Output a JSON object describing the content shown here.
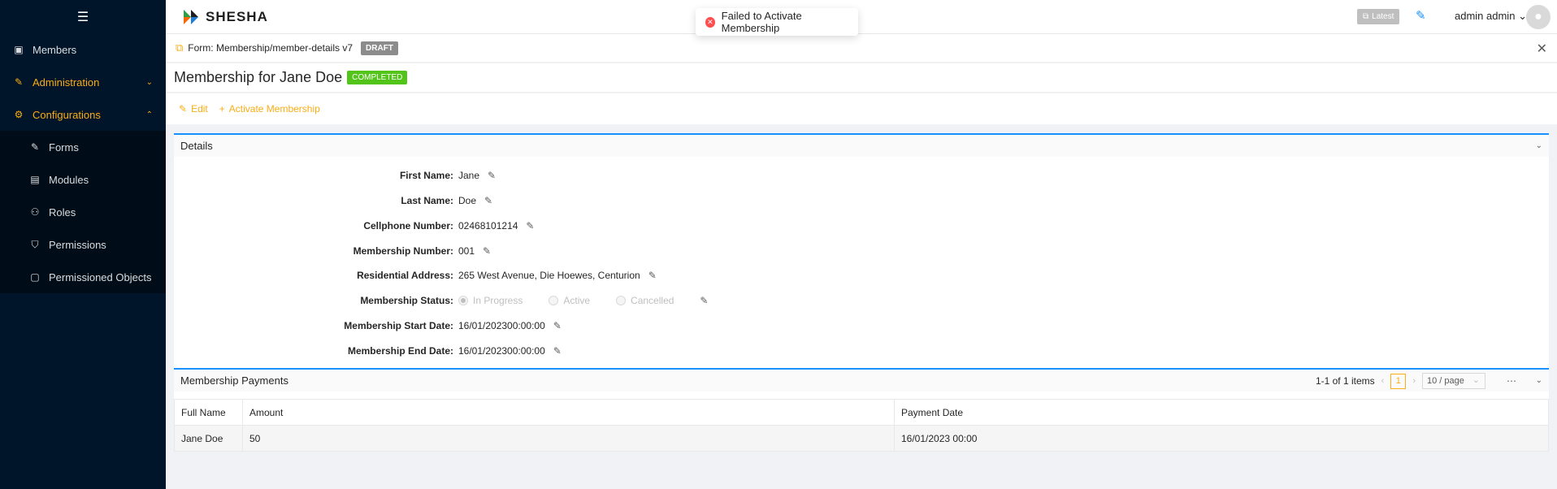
{
  "sidebar": {
    "items": [
      {
        "label": "Members"
      },
      {
        "label": "Administration"
      },
      {
        "label": "Configurations"
      }
    ],
    "submenu": [
      {
        "label": "Forms"
      },
      {
        "label": "Modules"
      },
      {
        "label": "Roles"
      },
      {
        "label": "Permissions"
      },
      {
        "label": "Permissioned Objects"
      }
    ]
  },
  "topbar": {
    "logo": "SHESHA",
    "toast": "Failed to Activate Membership",
    "latest": "Latest",
    "user": "admin admin"
  },
  "formbar": {
    "title": "Form: Membership/member-details v7",
    "badge": "DRAFT"
  },
  "page": {
    "title": "Membership for Jane Doe",
    "status": "COMPLETED"
  },
  "actions": {
    "edit": "Edit",
    "activate": "Activate Membership"
  },
  "details": {
    "header": "Details",
    "fields": [
      {
        "label": "First Name:",
        "value": "Jane"
      },
      {
        "label": "Last Name:",
        "value": "Doe"
      },
      {
        "label": "Cellphone Number:",
        "value": "02468101214"
      },
      {
        "label": "Membership Number:",
        "value": "001"
      },
      {
        "label": "Residential Address:",
        "value": "265 West Avenue, Die Hoewes, Centurion"
      },
      {
        "label": "Membership Status:",
        "options": [
          "In Progress",
          "Active",
          "Cancelled"
        ],
        "selected": "In Progress"
      },
      {
        "label": "Membership Start Date:",
        "value": "16/01/202300:00:00"
      },
      {
        "label": "Membership End Date:",
        "value": "16/01/202300:00:00"
      }
    ]
  },
  "payments": {
    "header": "Membership Payments",
    "summary": "1-1 of 1 items",
    "page": "1",
    "page_size": "10 / page",
    "columns": [
      "Full Name",
      "Amount",
      "Payment Date"
    ],
    "rows": [
      [
        "Jane Doe",
        "50",
        "16/01/2023 00:00"
      ]
    ]
  },
  "colors": {
    "sidebar_bg": "#001529",
    "accent": "#faad14",
    "primary": "#1890ff",
    "success": "#52c41a",
    "error": "#ff4d4f"
  }
}
